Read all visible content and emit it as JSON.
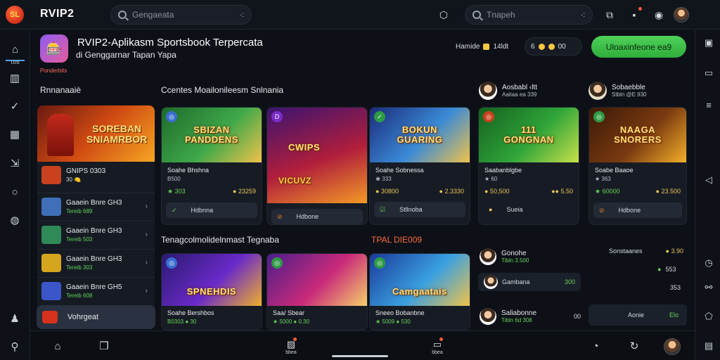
{
  "header": {
    "logo_text": "SL",
    "brand": "RVIP2",
    "search_left": {
      "placeholder": "Gengaeata",
      "shortcut": "·:"
    },
    "search_right": {
      "placeholder": "Tnapeh",
      "shortcut": "·:"
    }
  },
  "rail": {
    "items": [
      {
        "icon": "home-icon",
        "label": "Ucti"
      },
      {
        "icon": "building-icon"
      },
      {
        "icon": "check-circle-icon"
      },
      {
        "icon": "grid-icon"
      },
      {
        "icon": "export-icon"
      },
      {
        "icon": "circle-icon"
      },
      {
        "icon": "compass-icon"
      },
      {
        "icon": "bell-icon"
      },
      {
        "icon": "search-icon"
      }
    ]
  },
  "app": {
    "title_line1": "RVIP2-Aplikasm Sportsbook Terpercata",
    "title_line2": "di Genggarnar Tapan Yapa",
    "tag": "Ponderbits"
  },
  "stats": [
    {
      "label": "Hamide",
      "value": "14ldt"
    },
    {
      "label": "6",
      "value": "00"
    }
  ],
  "cta_label": "Uloaxinfeone ea9",
  "sections": {
    "left_title": "Rnnanaaiè",
    "middle_title": "Ccentes Moailonileesm Snlnania",
    "lower_title": "Tenagcolmolidelnmast Tegnaba",
    "lower_red_title": "TPAL DIE009"
  },
  "list": {
    "hero_text": "SOREBAN\nSNIAMRBOR",
    "items": [
      {
        "name": "GNIPS 0303",
        "sub": "30 🍋",
        "thumb": "#c9411f"
      },
      {
        "name": "Gaaein Bnre GH3",
        "sub": "Tereib 689",
        "thumb": "#3f6fb8"
      },
      {
        "name": "Gaaein Bnre GH3",
        "sub": "Tereib 503",
        "thumb": "#2f8a58"
      },
      {
        "name": "Gaaein Bnre GH3",
        "sub": "Tereib 303",
        "thumb": "#d6a51e"
      },
      {
        "name": "Gaaein Bnre GH5",
        "sub": "Tereib 608",
        "thumb": "#3a56c9"
      }
    ],
    "bottom_label": "Vohrgeat"
  },
  "cards_top": [
    {
      "art": "SBIZAN\nPANDDENS",
      "bg": "linear-gradient(135deg,#1d6b2a,#3fa84a 55%,#f0c24a)",
      "badge": "◎",
      "badge_bg": "#3a6dcf",
      "name": "Soahe Bhshna",
      "sub": "B500",
      "stat_l": "★ 303",
      "stat_r": "● 23259",
      "btn_icon": "✓",
      "btn": "Hdbnna"
    },
    {
      "art": "CWIPS",
      "bg": "linear-gradient(135deg,#3b1470,#b11e3c 55%,#f29a26)",
      "badge": "D",
      "badge_bg": "#7b2cc9",
      "name": "VICUVZ",
      "sub": "",
      "stat_l": "",
      "stat_r": "",
      "btn_icon": "⊘",
      "btn": "Hdbone"
    },
    {
      "art": "BOKUN\nGUARING",
      "bg": "linear-gradient(135deg,#1b2a7a,#3a8ad6 55%,#f0c24a)",
      "badge": "✓",
      "badge_bg": "#2e9b45",
      "name": "Soahe Sobnessa",
      "sub": "♚ 333",
      "stat_l": "● 30800",
      "stat_r": "● 2.3330",
      "btn_icon": "☑",
      "btn": "Stllnoba"
    },
    {
      "art": "111\nGONGNAN",
      "bg": "linear-gradient(135deg,#15601e,#2fa53a 55%,#c9e04a)",
      "badge": "◎",
      "badge_bg": "#c9411f",
      "name": "Saabanblgbe",
      "sub": "★ 60",
      "stat_l": "● 50,500",
      "stat_r": "●● 5.50",
      "btn_icon": "●",
      "btn": "Sueia"
    },
    {
      "art": "NAAGA\nSNORERS",
      "bg": "linear-gradient(135deg,#3a1a08,#7a3a10 55%,#f5b02a)",
      "badge": "◎",
      "badge_bg": "#2e9b45",
      "name": "Soabe Baaoe",
      "sub": "★ 363",
      "stat_l": "★ 60000",
      "stat_r": "● 23.500",
      "btn_icon": "⊘",
      "btn": "Hdbone"
    }
  ],
  "cards_bottom": [
    {
      "art": "SPNEHDIS",
      "bg": "linear-gradient(135deg,#2a1a70,#6a2ac9 55%,#f0b02a)",
      "badge": "◎",
      "badge_bg": "#3a6dcf",
      "name": "Soahe Bershbos",
      "sub": "B0303 ● 30"
    },
    {
      "art": "",
      "bg": "linear-gradient(135deg,#4a1e8a,#c92a7a 55%,#f5d06a)",
      "badge": "◎",
      "badge_bg": "#2e9b45",
      "name": "Saa/ Sbear",
      "sub": "★ 5000 ● 0.30"
    },
    {
      "art": "Camgaatais",
      "bg": "linear-gradient(135deg,#1a3a9a,#3aa0e0 55%,#f0c24a)",
      "badge": "◎",
      "badge_bg": "#2e9b45",
      "name": "Sneeo Bobanbne",
      "sub": "★ 5009 ● 530"
    }
  ],
  "featured_users": [
    {
      "name": "Aosbabl ‹ltt",
      "sub": "Aaitaa ea 339"
    },
    {
      "name": "Sobaebble",
      "sub": "Stbln @E 930"
    }
  ],
  "right_list": [
    {
      "name": "Gonohe",
      "sub": "Tibln 3.500",
      "value": "● 3.90"
    },
    {
      "name": "Gambana",
      "sub": "",
      "value": "300"
    },
    {
      "name": "Saliabonne",
      "sub": "Tibln 6d 308",
      "value": "00"
    }
  ],
  "right_stats": [
    {
      "label": "Sonstaanes",
      "value": "● 3.90"
    },
    {
      "label": "●",
      "value": "553"
    },
    {
      "label": "",
      "value": "353"
    }
  ],
  "right_button": {
    "label": "Aonie",
    "value": "Elo"
  },
  "bottombar": {
    "items": [
      {
        "icon": "home-icon"
      },
      {
        "icon": "tabs-icon"
      },
      {
        "icon": "image-icon",
        "label": "bbea"
      },
      {
        "icon": "chat-icon",
        "label": "bbea"
      },
      {
        "icon": "compass-icon"
      },
      {
        "icon": "refresh-icon"
      }
    ]
  }
}
